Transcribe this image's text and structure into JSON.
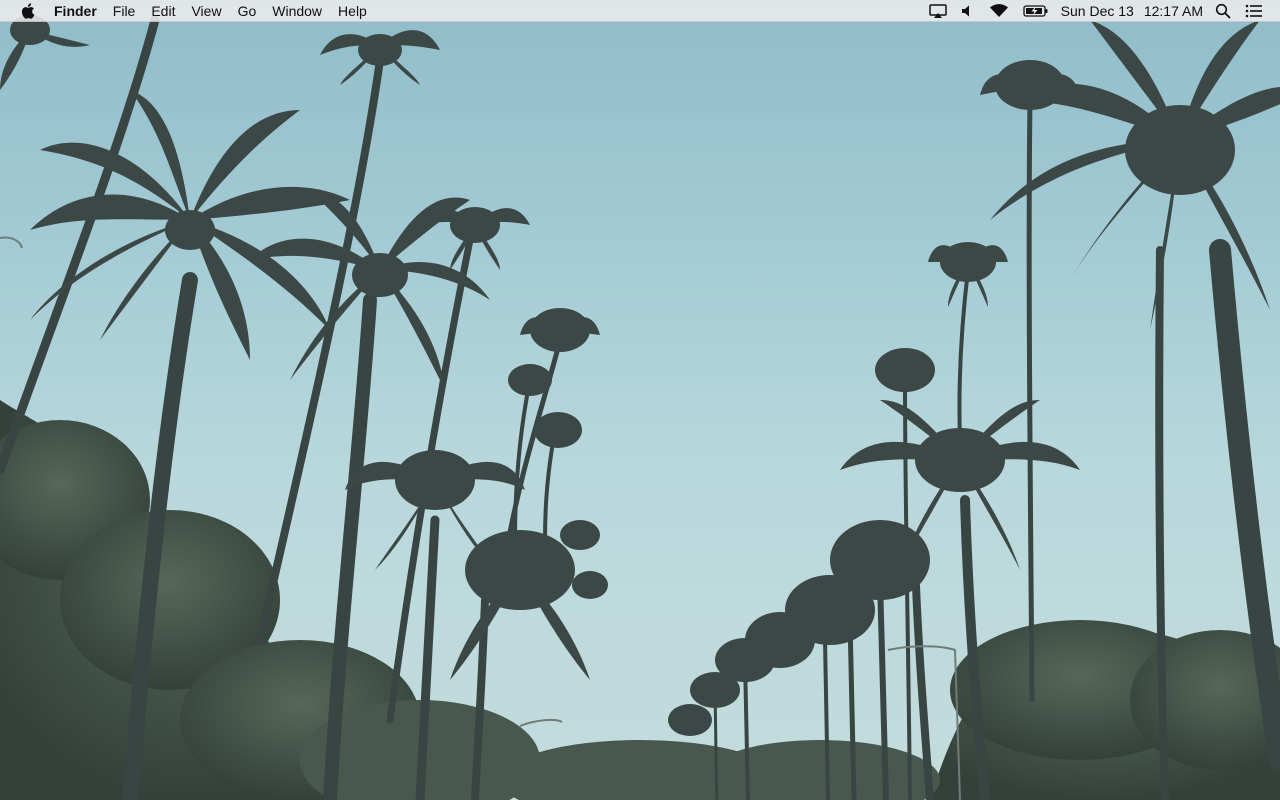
{
  "menubar": {
    "app_name": "Finder",
    "menus": [
      "File",
      "Edit",
      "View",
      "Go",
      "Window",
      "Help"
    ],
    "clock": {
      "date": "Sun Dec 13",
      "time": "12:17 AM"
    },
    "status_icons": [
      "airplay-icon",
      "volume-icon",
      "wifi-icon",
      "battery-charging-icon",
      "spotlight-search-icon",
      "notification-center-icon"
    ]
  },
  "desktop": {
    "wallpaper": "palm-trees-wallpaper",
    "colors": {
      "sky_top": "#8fbcc9",
      "sky_bottom": "#c4dcdc",
      "silhouette": "#3a4646",
      "foliage": "#3f4f45"
    }
  }
}
